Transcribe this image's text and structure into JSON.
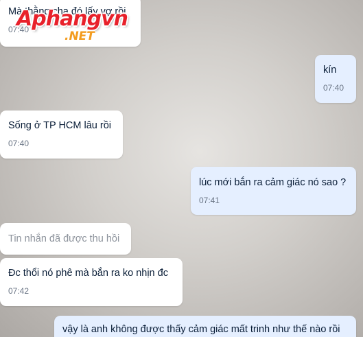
{
  "watermark": {
    "main": "Aphangvn",
    "sub": ".NET"
  },
  "messages": [
    {
      "direction": "incoming",
      "text": "Mà thằng cha đó lấy vợ rồi",
      "time": "07:40"
    },
    {
      "direction": "outgoing",
      "text": "kín",
      "time": "07:40"
    },
    {
      "direction": "incoming",
      "text": "Sống ở TP HCM lâu rồi",
      "time": "07:40"
    },
    {
      "direction": "outgoing",
      "text": "lúc mới bắn ra cảm giác nó sao ?",
      "time": "07:41"
    },
    {
      "direction": "incoming",
      "text": "Tin nhắn đã được thu hồi",
      "recalled": true
    },
    {
      "direction": "incoming",
      "text": "Đc thổi nó phê mà bắn ra ko nhịn đc",
      "time": "07:42"
    },
    {
      "direction": "outgoing",
      "text": "vậy là anh không được thấy cảm giác mất trinh như thế nào rồi"
    }
  ],
  "colors": {
    "incoming_bubble": "#ffffff",
    "outgoing_bubble": "#e5efff",
    "text": "#081c36",
    "time": "#6b7686",
    "recalled_text": "#8d939c",
    "watermark_red": "#e8212b",
    "watermark_orange": "#f39c1f"
  }
}
